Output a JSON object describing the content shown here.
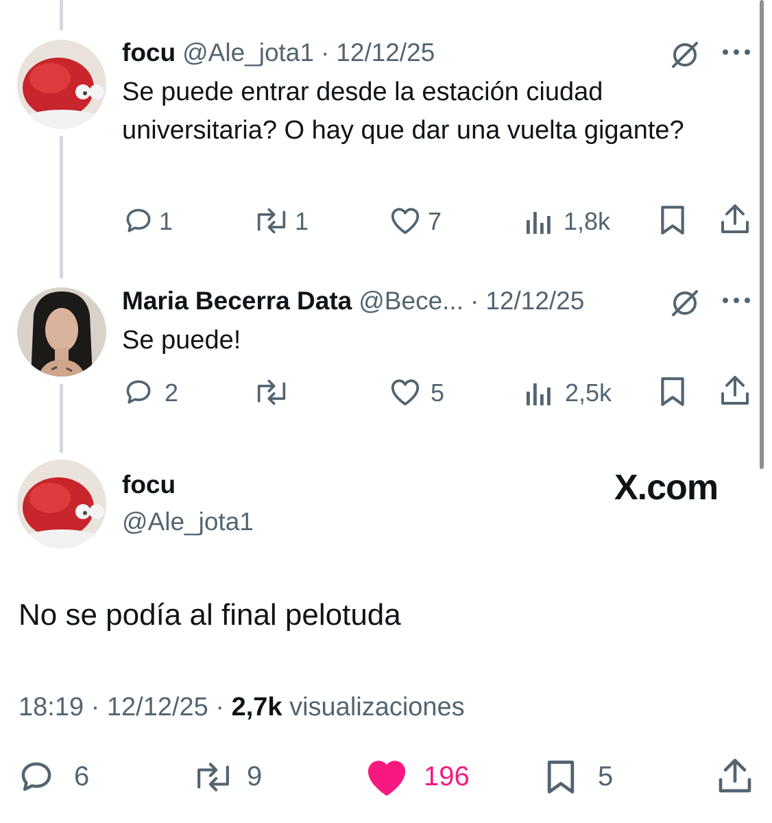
{
  "tweets": [
    {
      "name": "focu",
      "handle": "@Ale_jota1",
      "separator": "·",
      "date": "12/12/25",
      "text": "Se puede entrar desde la estación ciudad universitaria? O hay que dar una vuelta gigante?",
      "replies": "1",
      "retweets": "1",
      "likes": "7",
      "views": "1,8k"
    },
    {
      "name": "Maria Becerra Data",
      "handle": "@Bece...",
      "separator": "·",
      "date": "12/12/25",
      "text": "Se puede!",
      "replies": "2",
      "retweets": "",
      "likes": "5",
      "views": "2,5k"
    }
  ],
  "main_tweet": {
    "name": "focu",
    "handle": "@Ale_jota1",
    "text": "No se podía al final pelotuda",
    "time": "18:19",
    "date": "12/12/25",
    "separator": "·",
    "views_count": "2,7k",
    "views_label": "visualizaciones",
    "replies": "6",
    "retweets": "9",
    "likes": "196",
    "bookmarks": "5"
  },
  "watermark": "X.com",
  "colors": {
    "text": "#0f1419",
    "secondary": "#536471",
    "like_active": "#f91880",
    "thread_line": "#cfd9de"
  },
  "icons": [
    "reply-icon",
    "retweet-icon",
    "like-icon",
    "views-icon",
    "bookmark-icon",
    "share-icon",
    "grok-icon",
    "more-icon"
  ]
}
